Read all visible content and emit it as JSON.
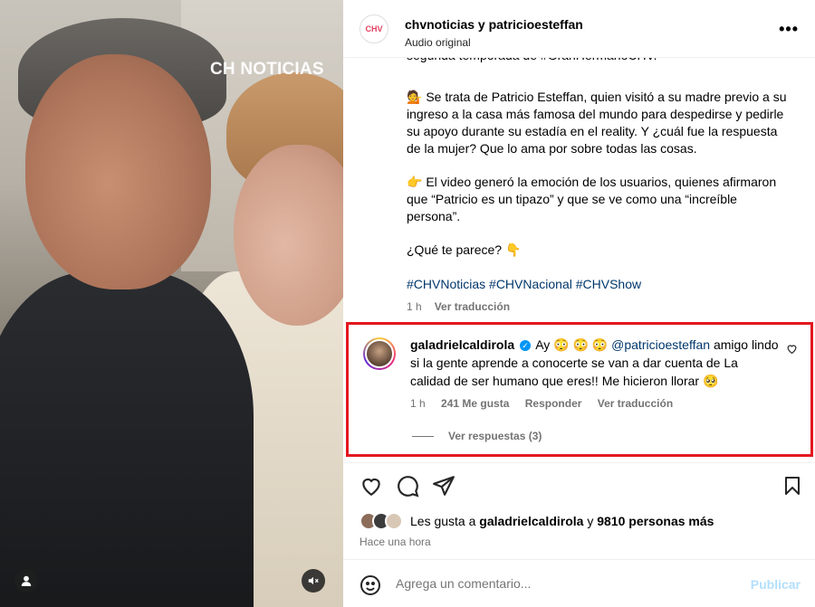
{
  "media": {
    "brand_watermark": "CH NOTICIAS"
  },
  "header": {
    "avatar_text": "CHV",
    "title": "chvnoticias y patricioesteffan",
    "subtitle": "Audio original",
    "more": "•••"
  },
  "caption": {
    "cut_line": "segunda temporada de #GranHermanoCHV.",
    "para1_emoji": "💁",
    "para1": "Se trata de Patricio Esteffan, quien visitó a su madre previo a su ingreso a la casa más famosa del mundo para despedirse y pedirle su apoyo durante su estadía en el reality. Y ¿cuál fue la respuesta de la mujer? Que lo ama por sobre todas las cosas.",
    "para2_emoji": "👉",
    "para2": "El video generó la emoción de los usuarios, quienes afirmaron que “Patricio es un tipazo” y que se ve como una “increíble persona”.",
    "para3": "¿Qué te parece? 👇",
    "hashtags": "#CHVNoticias #CHVNacional #CHVShow",
    "time": "1 h",
    "translate": "Ver traducción"
  },
  "comment": {
    "user": "galadrielcaldirola",
    "text_before": "Ay 😳 😳 😳",
    "mention": "@patricioesteffan",
    "text_after": "amigo lindo si la gente aprende a conocerte se van a dar cuenta de La calidad de ser humano que eres!! Me hicieron llorar 🥺",
    "time": "1 h",
    "likes": "241 Me gusta",
    "reply": "Responder",
    "translate": "Ver traducción",
    "view_replies": "Ver respuestas (3)"
  },
  "likes": {
    "prefix": "Les gusta a",
    "user": "galadrielcaldirola",
    "middle": "y",
    "rest": "9810 personas más"
  },
  "time_ago": "Hace una hora",
  "compose": {
    "placeholder": "Agrega un comentario...",
    "post_label": "Publicar"
  }
}
